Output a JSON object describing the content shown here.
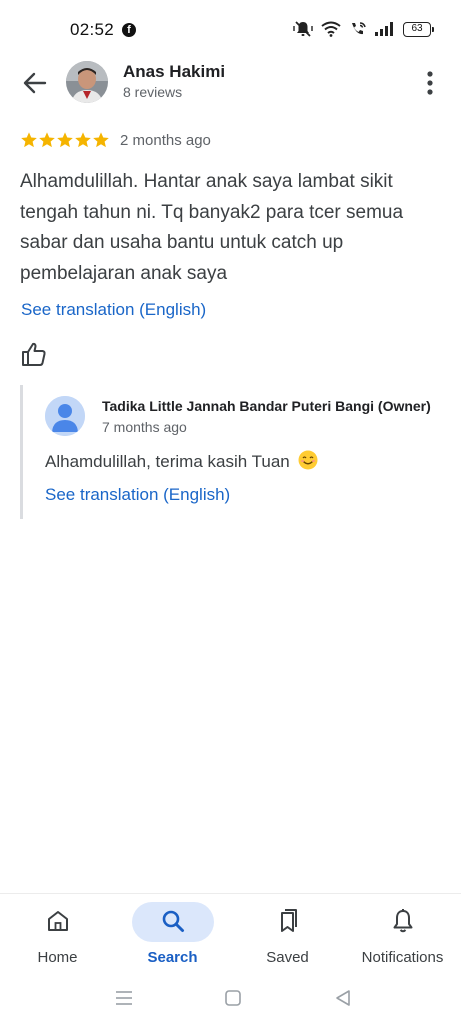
{
  "status_bar": {
    "time": "02:52",
    "app_icon": "facebook-icon",
    "battery": "63",
    "icons": [
      "mute-vibrate-icon",
      "wifi-icon",
      "wifi-call-icon",
      "signal-icon",
      "battery-icon"
    ]
  },
  "header": {
    "reviewer_name": "Anas Hakimi",
    "review_count": "8 reviews"
  },
  "review": {
    "rating": 5,
    "time_ago": "2 months ago",
    "text": "Alhamdulillah. Hantar anak saya lambat sikit tengah tahun ni. Tq banyak2 para tcer semua sabar dan usaha bantu untuk catch up pembelajaran anak saya",
    "translate_label": "See translation (English)"
  },
  "owner_reply": {
    "name": "Tadika Little Jannah Bandar Puteri Bangi (Owner)",
    "time_ago": "7 months ago",
    "text": "Alhamdulillah, terima kasih Tuan",
    "translate_label": "See translation (English)"
  },
  "bottom_nav": {
    "items": [
      {
        "label": "Home",
        "icon": "home-icon",
        "active": false
      },
      {
        "label": "Search",
        "icon": "search-icon",
        "active": true
      },
      {
        "label": "Saved",
        "icon": "bookmark-icon",
        "active": false
      },
      {
        "label": "Notifications",
        "icon": "bell-icon",
        "active": false
      }
    ]
  },
  "colors": {
    "star": "#F5B400",
    "link": "#1A66C8",
    "active_nav": "#1A5FC4",
    "active_pill": "#DBE7FB"
  }
}
